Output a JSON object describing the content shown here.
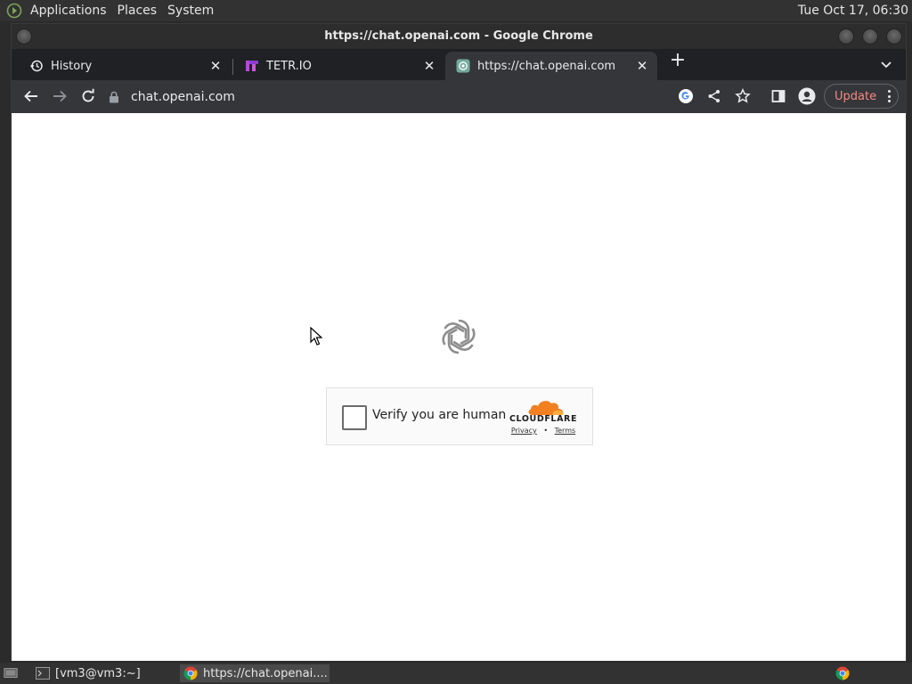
{
  "top_panel": {
    "menus": [
      "Applications",
      "Places",
      "System"
    ],
    "clock": "Tue Oct 17, 06:30"
  },
  "window": {
    "title": "https://chat.openai.com - Google Chrome"
  },
  "tabs": [
    {
      "label": "History",
      "icon": "history-icon"
    },
    {
      "label": "TETR.IO",
      "icon": "tetrio-icon"
    },
    {
      "label": "https://chat.openai.com",
      "icon": "openai-icon"
    }
  ],
  "toolbar": {
    "url": "chat.openai.com",
    "update_label": "Update"
  },
  "captcha": {
    "label": "Verify you are human",
    "brand": "CLOUDFLARE",
    "privacy": "Privacy",
    "separator": "•",
    "terms": "Terms"
  },
  "taskbar": {
    "items": [
      {
        "label": "[vm3@vm3:~]",
        "icon": "terminal-icon"
      },
      {
        "label": "https://chat.openai....",
        "icon": "chrome-icon"
      }
    ]
  },
  "colors": {
    "accent_update": "#f28b82",
    "cloudflare_orange": "#f38020",
    "chrome_dark": "#35363a"
  }
}
